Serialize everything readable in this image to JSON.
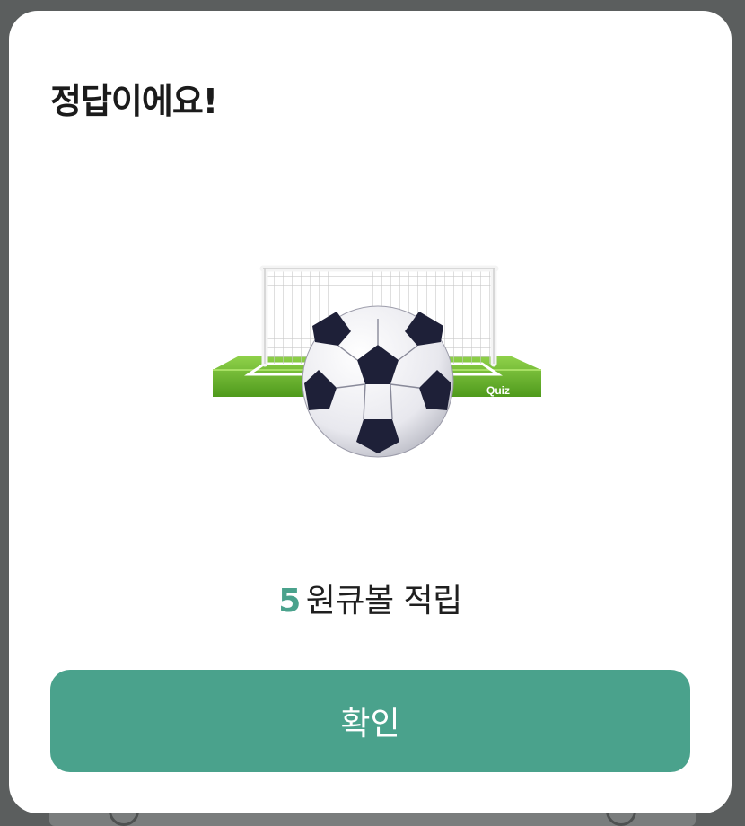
{
  "modal": {
    "title": "정답이에요!",
    "illustration": {
      "icon": "soccer-goal-ball",
      "badge_text": "Quiz"
    },
    "reward": {
      "amount": "5",
      "text": "원큐볼 적립"
    },
    "confirm_label": "확인"
  },
  "colors": {
    "accent": "#4aa28c",
    "title_text": "#1b1b1b",
    "overlay": "#5b5e5e",
    "modal_bg": "#ffffff"
  }
}
